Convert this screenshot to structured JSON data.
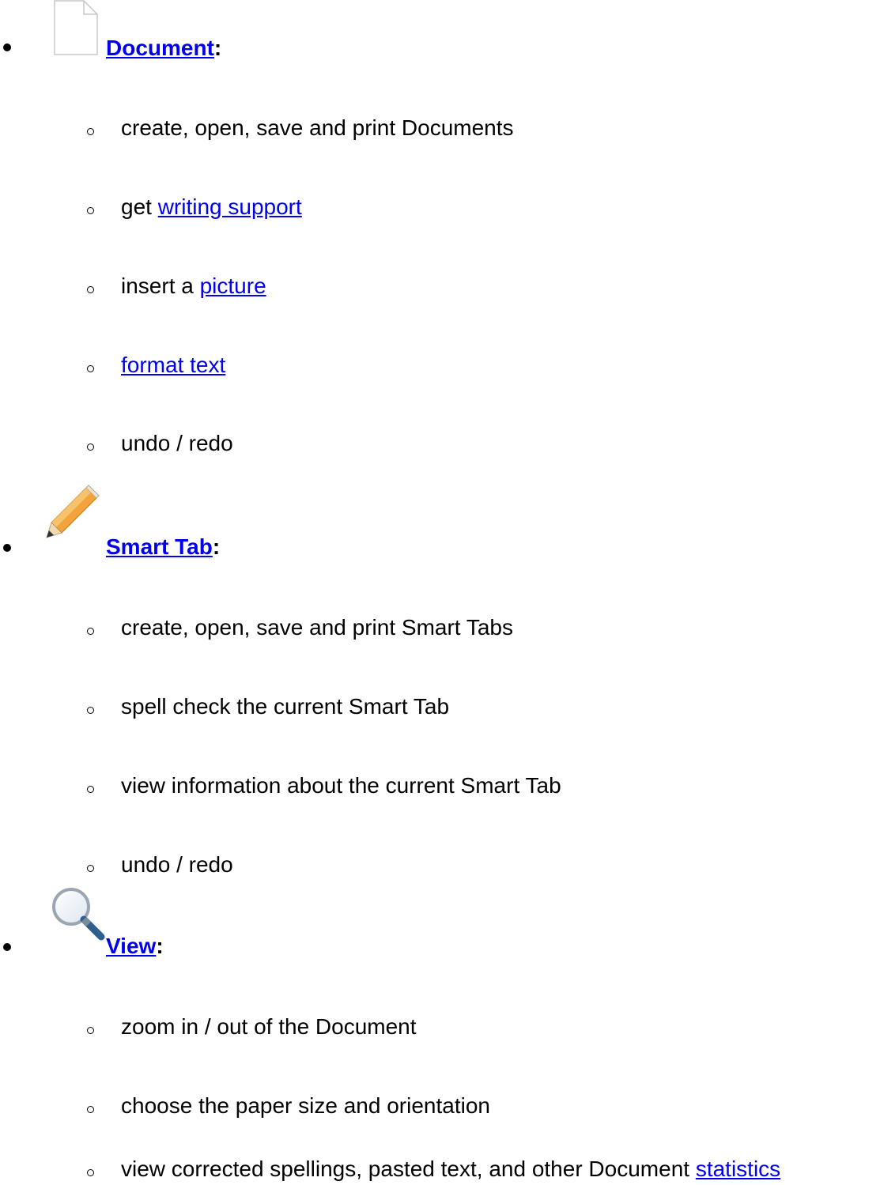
{
  "sections": [
    {
      "icon": "document-icon",
      "link": "Document",
      "suffix": ":",
      "items": [
        {
          "pre": "create, open, save and print Documents"
        },
        {
          "pre": "get ",
          "link": "writing support"
        },
        {
          "pre": "insert a ",
          "link": "picture"
        },
        {
          "pre": "",
          "link": "format text"
        },
        {
          "pre": "undo / redo"
        }
      ]
    },
    {
      "icon": "pencil-icon",
      "link": "Smart Tab",
      "suffix": ":",
      "items": [
        {
          "pre": "create, open, save and print Smart Tabs"
        },
        {
          "pre": "spell check the current Smart Tab"
        },
        {
          "pre": "view information about the current Smart Tab"
        },
        {
          "pre": "undo / redo"
        }
      ]
    },
    {
      "icon": "magnifier-icon",
      "link": "View",
      "suffix": ":",
      "items": [
        {
          "pre": "zoom in / out of the Document"
        },
        {
          "pre": "choose the paper size and orientation"
        },
        {
          "pre": "view corrected spellings, pasted text, and other Document ",
          "link": "statistics"
        }
      ]
    }
  ]
}
